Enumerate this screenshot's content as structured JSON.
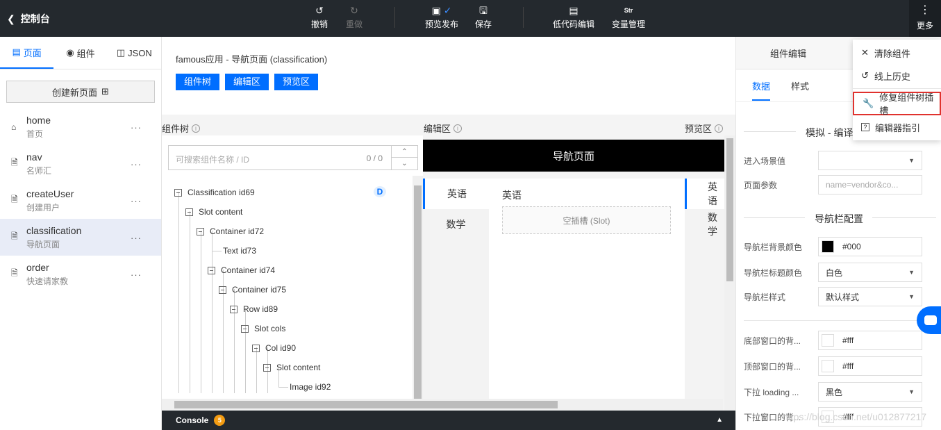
{
  "topbar": {
    "back_label": "控制台",
    "undo": "撤销",
    "redo": "重做",
    "preview_publish": "预览发布",
    "save": "保存",
    "lowcode": "低代码编辑",
    "lowcode_icon_text": "Str",
    "variables": "变量管理",
    "more": "更多"
  },
  "sidebar": {
    "tabs": [
      {
        "label": "页面",
        "active": true
      },
      {
        "label": "组件",
        "active": false
      },
      {
        "label": "JSON",
        "active": false
      }
    ],
    "new_page": "创建新页面",
    "pages": [
      {
        "name": "home",
        "title": "首页",
        "icon": "home-icon"
      },
      {
        "name": "nav",
        "title": "名师汇",
        "icon": "file-icon"
      },
      {
        "name": "createUser",
        "title": "创建用户",
        "icon": "file-icon"
      },
      {
        "name": "classification",
        "title": "导航页面",
        "icon": "file-icon",
        "selected": true
      },
      {
        "name": "order",
        "title": "快速请家教",
        "icon": "file-icon"
      }
    ],
    "more_glyph": "···"
  },
  "main": {
    "title": "famous应用 - 导航页面 (classification)",
    "buttons": [
      "组件树",
      "编辑区",
      "预览区"
    ],
    "tree_label": "组件树",
    "editor_label": "编辑区",
    "preview_label": "预览区",
    "search_placeholder": "可搜索组件名称 / ID",
    "search_count": "0 / 0",
    "d_badge": "D",
    "tree": [
      "Classification id69",
      "Slot content",
      "Container id72",
      "Text id73",
      "Container id74",
      "Container id75",
      "Row id89",
      "Slot cols",
      "Col id90",
      "Slot content",
      "Image id92"
    ],
    "canvas": {
      "nav_title": "导航页面",
      "menu_items": [
        "英语",
        "数学"
      ],
      "body_heading": "英语",
      "slot_text": "空插槽 (Slot)",
      "preview_items": [
        "英语",
        "数学"
      ]
    }
  },
  "console": {
    "label": "Console",
    "count": "5"
  },
  "right": {
    "tab": "组件编辑",
    "subtabs": [
      "数据",
      "样式"
    ],
    "section_sim": "模拟 - 编译",
    "fields1": [
      {
        "label": "进入场景值",
        "value": "",
        "type": "select"
      },
      {
        "label": "页面参数",
        "placeholder": "name=vendor&co..."
      }
    ],
    "section_nav": "导航栏配置",
    "fields2": [
      {
        "label": "导航栏背景颜色",
        "value": "#000",
        "swatch": "#000000"
      },
      {
        "label": "导航栏标题颜色",
        "value": "白色",
        "type": "select"
      },
      {
        "label": "导航栏样式",
        "value": "默认样式",
        "type": "select"
      }
    ],
    "fields3": [
      {
        "label": "底部窗口的背...",
        "value": "#fff",
        "swatch": "#ffffff"
      },
      {
        "label": "顶部窗口的背...",
        "value": "#fff",
        "swatch": "#ffffff"
      },
      {
        "label": "下拉 loading ...",
        "value": "黑色",
        "type": "select"
      },
      {
        "label": "下拉窗口的背...",
        "value": "#fff",
        "swatch": "#ffffff"
      }
    ]
  },
  "dropdown": {
    "items": [
      {
        "label": "清除组件",
        "icon": "close-icon"
      },
      {
        "label": "线上历史",
        "icon": "history-icon"
      },
      {
        "label": "修复组件树插槽",
        "icon": "wrench-icon",
        "highlighted": true
      },
      {
        "label": "编辑器指引",
        "icon": "help-icon"
      }
    ]
  },
  "watermark": "https://blog.csdn.net/u012877217",
  "colors": {
    "accent": "#006eff",
    "topbar": "#24292e",
    "highlight": "#e0322e"
  }
}
